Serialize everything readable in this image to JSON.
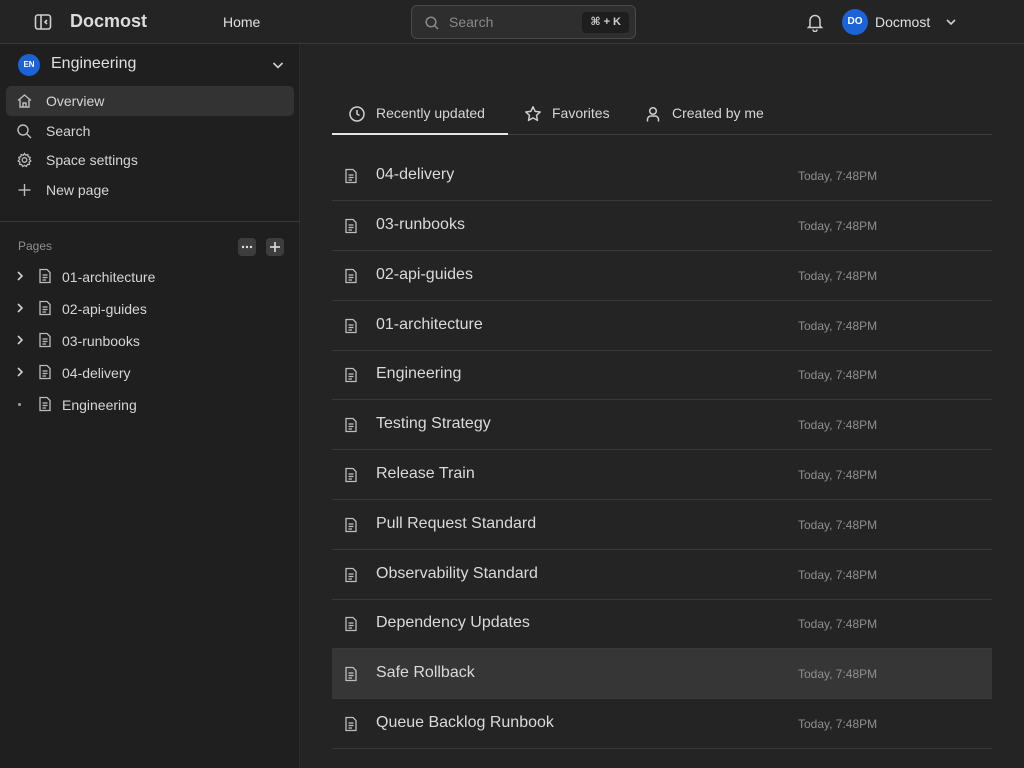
{
  "header": {
    "app_title": "Docmost",
    "home_label": "Home",
    "search_placeholder": "Search",
    "search_shortcut": "⌘ + K",
    "user_initials": "DO",
    "user_name": "Docmost"
  },
  "sidebar": {
    "space_initials": "EN",
    "space_name": "Engineering",
    "nav": [
      {
        "label": "Overview",
        "icon": "home-icon"
      },
      {
        "label": "Search",
        "icon": "search-icon"
      },
      {
        "label": "Space settings",
        "icon": "gear-icon"
      },
      {
        "label": "New page",
        "icon": "plus-icon"
      }
    ],
    "pages_label": "Pages",
    "tree": [
      {
        "label": "01-architecture",
        "expandable": true
      },
      {
        "label": "02-api-guides",
        "expandable": true
      },
      {
        "label": "03-runbooks",
        "expandable": true
      },
      {
        "label": "04-delivery",
        "expandable": true
      },
      {
        "label": "Engineering",
        "expandable": false
      }
    ]
  },
  "main": {
    "tabs": [
      {
        "label": "Recently updated",
        "icon": "clock-icon",
        "active": true
      },
      {
        "label": "Favorites",
        "icon": "star-icon",
        "active": false
      },
      {
        "label": "Created by me",
        "icon": "user-icon",
        "active": false
      }
    ],
    "pages": [
      {
        "title": "04-delivery",
        "updated": "Today, 7:48PM"
      },
      {
        "title": "03-runbooks",
        "updated": "Today, 7:48PM"
      },
      {
        "title": "02-api-guides",
        "updated": "Today, 7:48PM"
      },
      {
        "title": "01-architecture",
        "updated": "Today, 7:48PM"
      },
      {
        "title": "Engineering",
        "updated": "Today, 7:48PM"
      },
      {
        "title": "Testing Strategy",
        "updated": "Today, 7:48PM"
      },
      {
        "title": "Release Train",
        "updated": "Today, 7:48PM"
      },
      {
        "title": "Pull Request Standard",
        "updated": "Today, 7:48PM"
      },
      {
        "title": "Observability Standard",
        "updated": "Today, 7:48PM"
      },
      {
        "title": "Dependency Updates",
        "updated": "Today, 7:48PM"
      },
      {
        "title": "Safe Rollback",
        "updated": "Today, 7:48PM"
      },
      {
        "title": "Queue Backlog Runbook",
        "updated": "Today, 7:48PM"
      }
    ]
  },
  "colors": {
    "background": "#242424",
    "sidebar": "#1f1f1f",
    "accent_avatar": "#1c63d8",
    "text": "#dadada",
    "muted": "#8f8f8f"
  }
}
